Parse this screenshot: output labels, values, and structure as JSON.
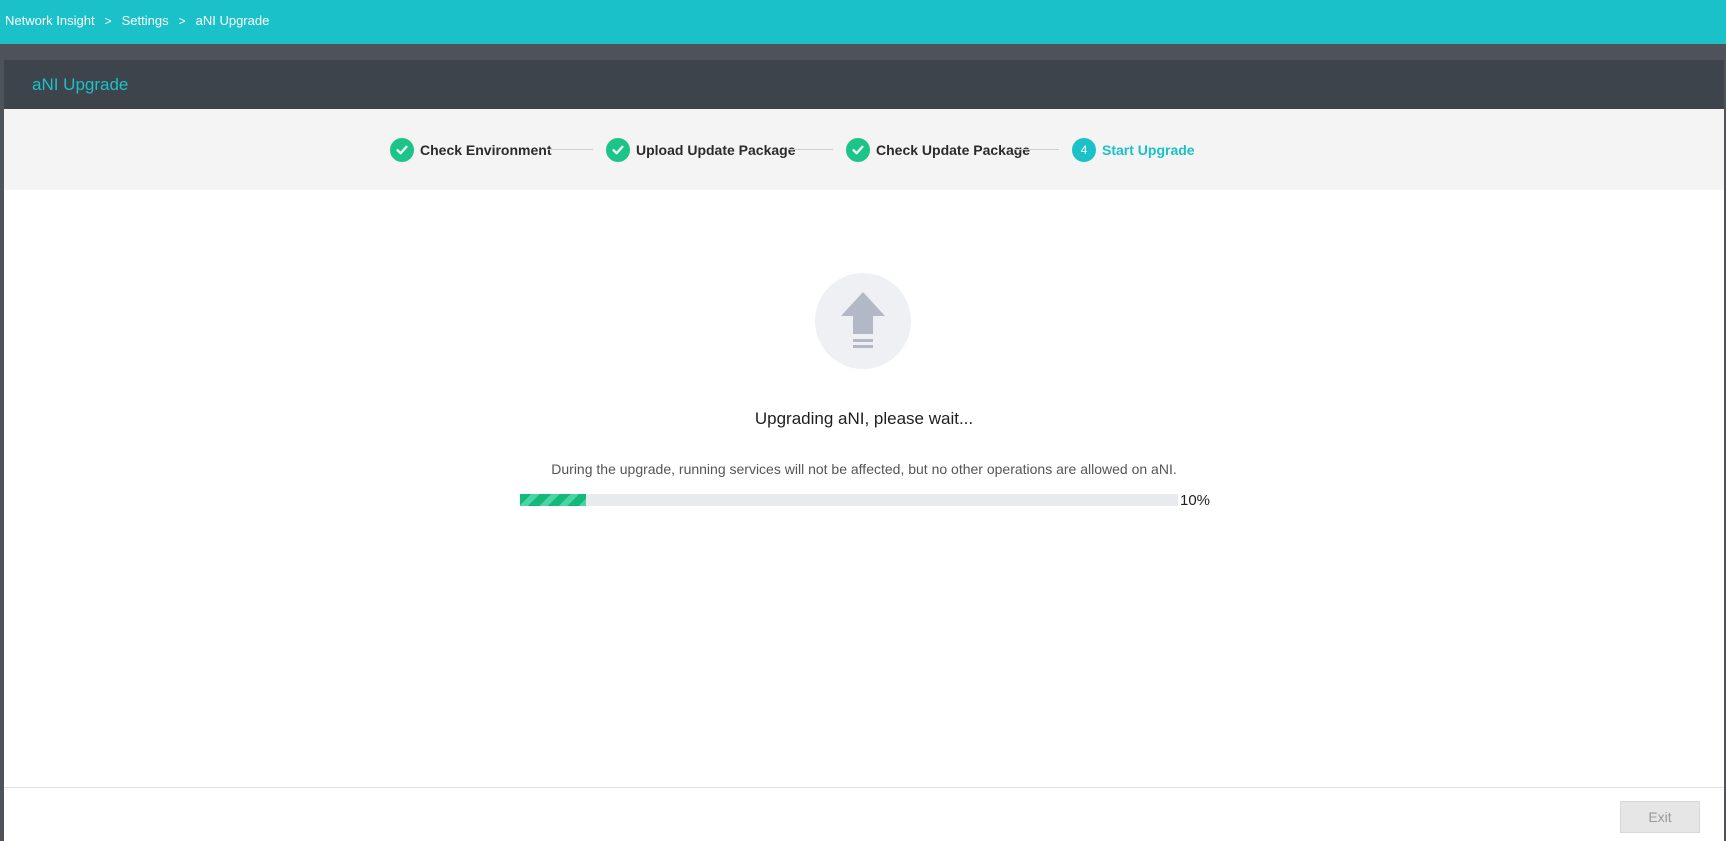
{
  "breadcrumb": {
    "items": [
      "Network Insight",
      "Settings",
      "aNI Upgrade"
    ],
    "separator": ">"
  },
  "panel": {
    "title": "aNI Upgrade"
  },
  "steps": [
    {
      "label": "Check Environment",
      "state": "done",
      "icon": "check-icon"
    },
    {
      "label": "Upload Update Package",
      "state": "done",
      "icon": "check-icon"
    },
    {
      "label": "Check Update Package",
      "state": "done",
      "icon": "check-icon"
    },
    {
      "label": "Start Upgrade",
      "state": "active",
      "number": "4"
    }
  ],
  "status": {
    "icon": "upload-arrow-icon",
    "title": "Upgrading aNI, please wait...",
    "description": "During the upgrade, running services will not be affected, but no other operations are allowed on aNI.",
    "progress_percent": 10,
    "progress_label": "10%"
  },
  "footer": {
    "exit_label": "Exit",
    "exit_disabled": true
  },
  "colors": {
    "accent": "#1bc1c8",
    "success": "#1dc488",
    "header_dark": "#3d444b"
  }
}
